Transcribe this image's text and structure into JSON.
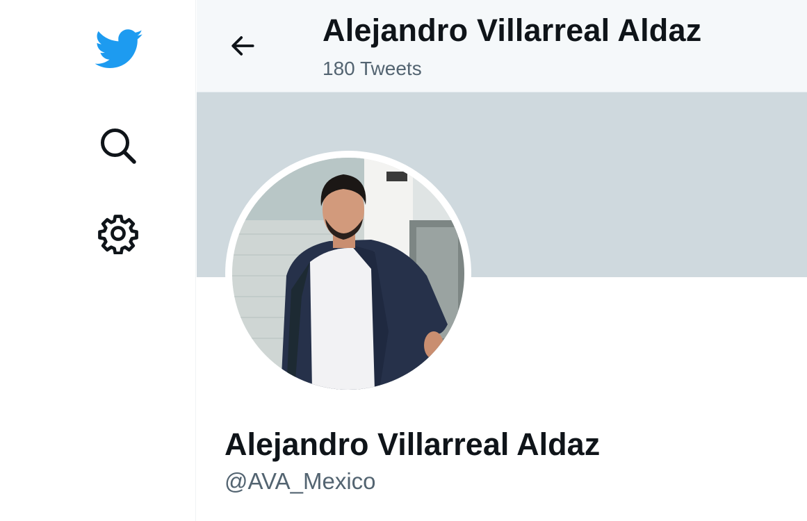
{
  "app": {
    "brand_color": "#1d9bf0",
    "icons": {
      "logo": "twitter-bird-icon",
      "search": "search-icon",
      "settings": "gear-icon",
      "back": "arrow-left-icon"
    }
  },
  "header": {
    "name": "Alejandro Villarreal Aldaz",
    "tweet_count": "180 Tweets"
  },
  "profile": {
    "name": "Alejandro Villarreal Aldaz",
    "handle": "@AVA_Mexico",
    "banner_color": "#cfd9de"
  }
}
